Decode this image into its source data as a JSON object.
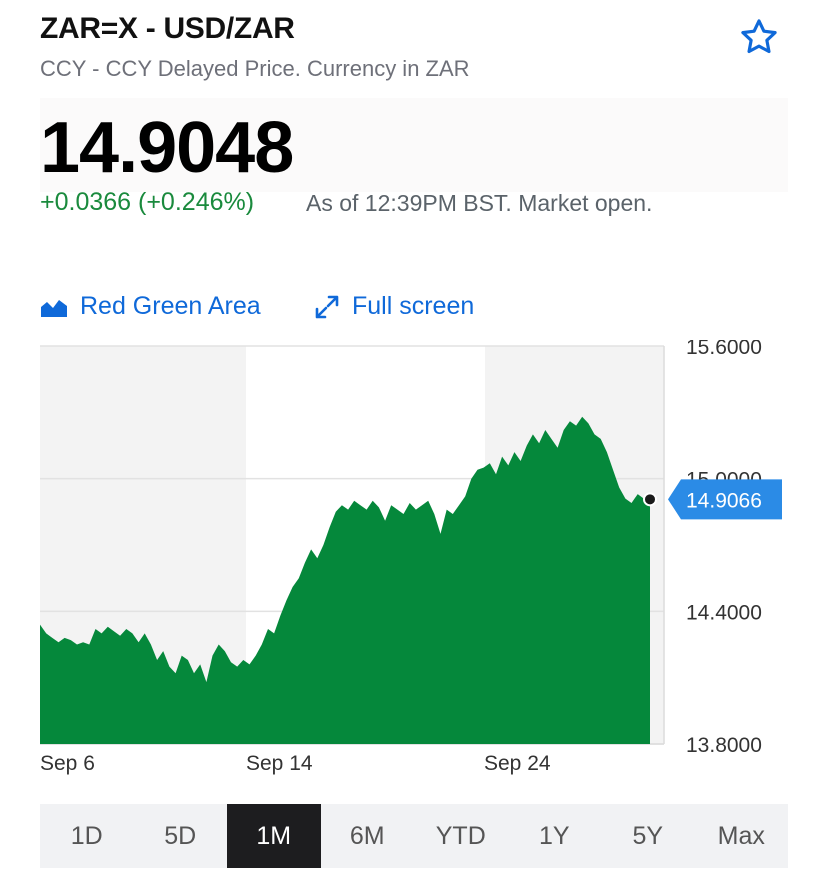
{
  "header": {
    "title": "ZAR=X - USD/ZAR",
    "subtitle": "CCY - CCY Delayed Price. Currency in ZAR"
  },
  "quote": {
    "price": "14.9048",
    "change": "+0.0366 (+0.246%)",
    "as_of": "As of 12:39PM BST. Market open."
  },
  "toolbar": {
    "chart_type_label": "Red Green Area",
    "fullscreen_label": "Full screen"
  },
  "chart_data": {
    "type": "area",
    "x_tick_labels": [
      "Sep 6",
      "Sep 14",
      "Sep 24"
    ],
    "y_tick_labels": [
      "15.6000",
      "15.0000",
      "14.4000",
      "13.8000"
    ],
    "ylim": [
      13.8,
      15.6
    ],
    "current_value_label": "14.9066",
    "current_value": 14.9066,
    "fill_color": "#05883b",
    "values": [
      14.34,
      14.3,
      14.28,
      14.26,
      14.28,
      14.27,
      14.25,
      14.26,
      14.25,
      14.32,
      14.3,
      14.33,
      14.31,
      14.29,
      14.32,
      14.3,
      14.26,
      14.3,
      14.25,
      14.18,
      14.22,
      14.15,
      14.12,
      14.2,
      14.18,
      14.12,
      14.16,
      14.08,
      14.2,
      14.25,
      14.22,
      14.17,
      14.15,
      14.18,
      14.16,
      14.2,
      14.25,
      14.32,
      14.3,
      14.38,
      14.45,
      14.51,
      14.55,
      14.62,
      14.68,
      14.64,
      14.7,
      14.78,
      14.85,
      14.88,
      14.86,
      14.9,
      14.88,
      14.86,
      14.9,
      14.87,
      14.81,
      14.88,
      14.86,
      14.84,
      14.89,
      14.86,
      14.88,
      14.9,
      14.84,
      14.75,
      14.86,
      14.84,
      14.88,
      14.92,
      15.0,
      15.04,
      15.05,
      15.07,
      15.02,
      15.1,
      15.06,
      15.12,
      15.08,
      15.15,
      15.2,
      15.16,
      15.22,
      15.18,
      15.14,
      15.22,
      15.26,
      15.24,
      15.28,
      15.25,
      15.2,
      15.18,
      15.12,
      15.04,
      14.96,
      14.91,
      14.89,
      14.93,
      14.91,
      14.9066
    ],
    "shaded_ranges": [
      [
        "Sep 6",
        "Sep 14"
      ],
      [
        "Sep 24",
        "end"
      ]
    ]
  },
  "ranges": {
    "items": [
      "1D",
      "5D",
      "1M",
      "6M",
      "YTD",
      "1Y",
      "5Y",
      "Max"
    ],
    "active": "1M"
  },
  "colors": {
    "accent": "#0f69d9",
    "positive": "#1a8a3d",
    "tag": "#2b8be6"
  }
}
